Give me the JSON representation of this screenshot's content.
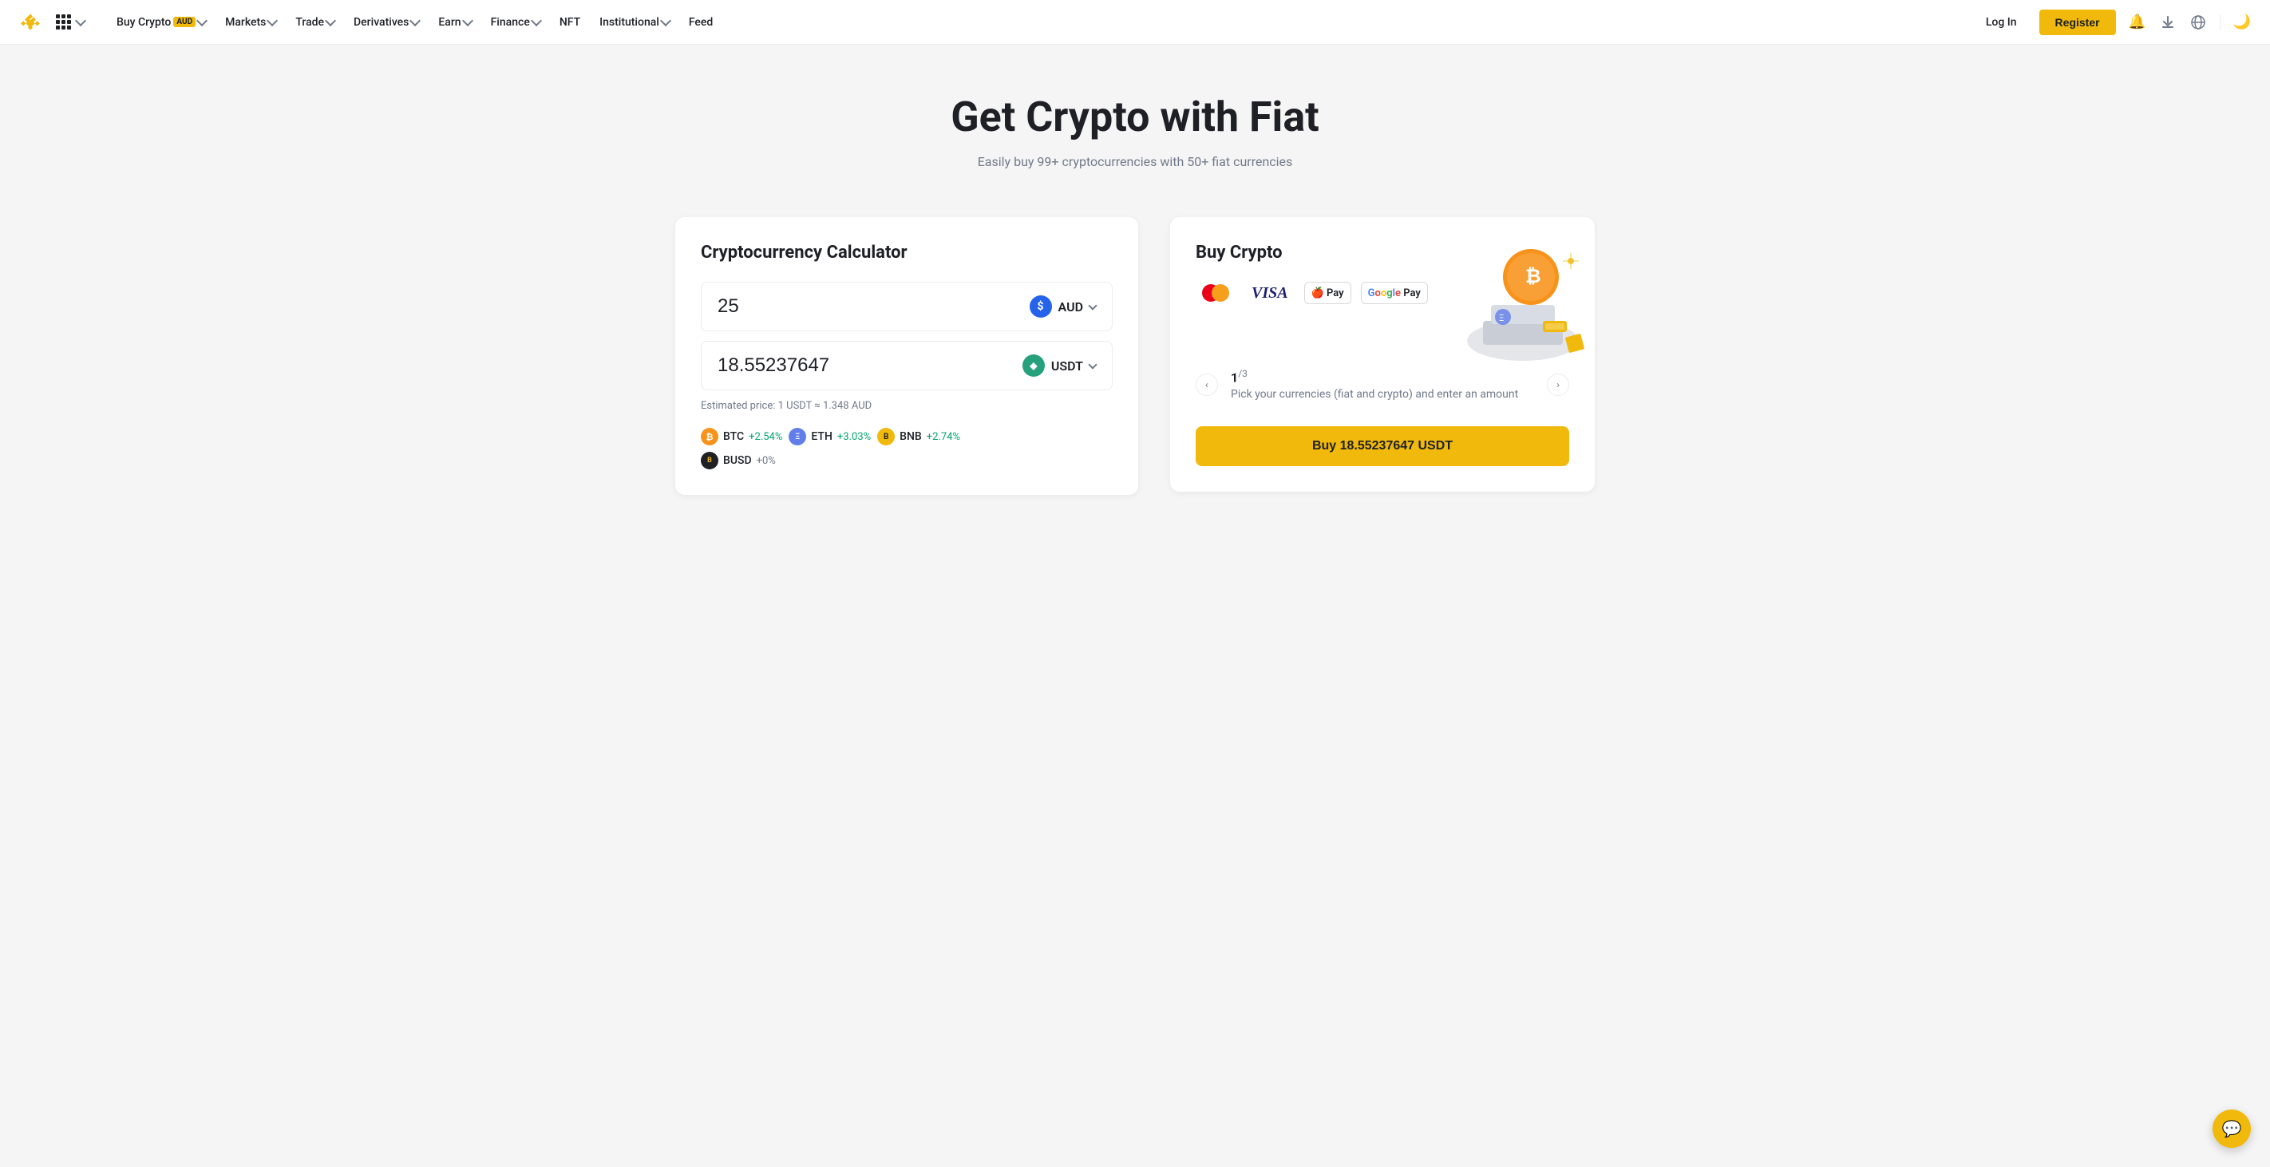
{
  "brand": {
    "name": "Binance",
    "logo_alt": "Binance Logo"
  },
  "navbar": {
    "grid_label": "Apps",
    "buy_crypto": "Buy Crypto",
    "buy_crypto_badge": "AUD",
    "markets": "Markets",
    "trade": "Trade",
    "derivatives": "Derivatives",
    "earn": "Earn",
    "finance": "Finance",
    "nft": "NFT",
    "institutional": "Institutional",
    "feed": "Feed",
    "login": "Log In",
    "register": "Register"
  },
  "hero": {
    "title": "Get Crypto with Fiat",
    "subtitle": "Easily buy 99+ cryptocurrencies with 50+ fiat currencies"
  },
  "calculator": {
    "title": "Cryptocurrency Calculator",
    "input_amount": "25",
    "input_currency": "AUD",
    "output_amount": "18.55237647",
    "output_currency": "USDT",
    "estimated_price": "Estimated price: 1 USDT ≈ 1.348 AUD",
    "cryptos": [
      {
        "symbol": "BTC",
        "change": "+2.54%",
        "positive": true
      },
      {
        "symbol": "ETH",
        "change": "+3.03%",
        "positive": true
      },
      {
        "symbol": "BNB",
        "change": "+2.74%",
        "positive": true
      },
      {
        "symbol": "BUSD",
        "change": "+0%",
        "positive": false
      }
    ]
  },
  "buy_crypto": {
    "title": "Buy Crypto",
    "step_current": "1",
    "step_total": "3",
    "step_description": "Pick your currencies (fiat and crypto) and enter an amount",
    "buy_button": "Buy 18.55237647 USDT",
    "prev_label": "‹",
    "next_label": "›"
  },
  "payment_methods": [
    "Mastercard",
    "Visa",
    "Apple Pay",
    "Google Pay"
  ],
  "chat": {
    "icon": "💬"
  }
}
